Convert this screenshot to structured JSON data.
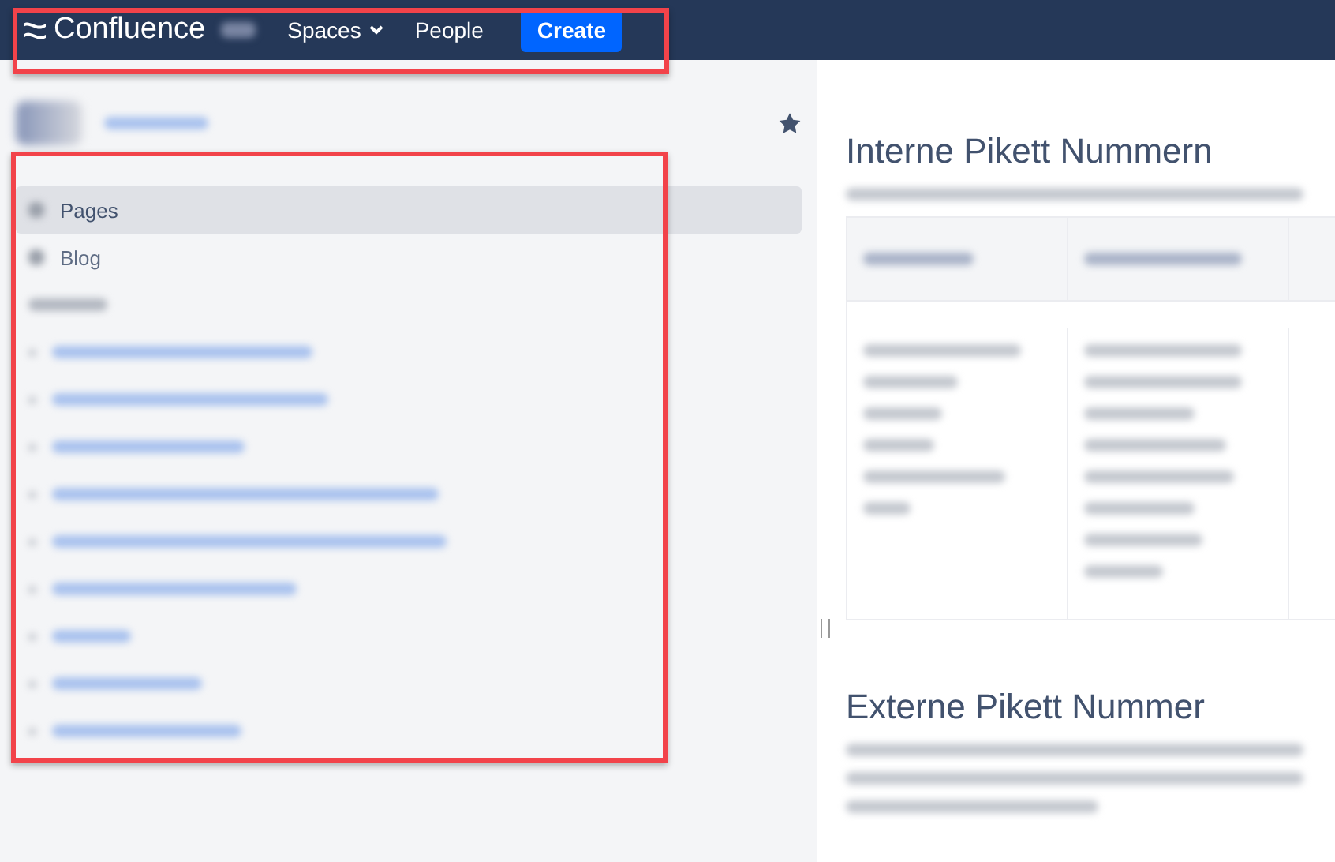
{
  "top_nav": {
    "product": "Confluence",
    "items": [
      {
        "label": "Spaces",
        "kind": "dropdown"
      },
      {
        "label": "People",
        "kind": "link"
      }
    ],
    "create_button": "Create"
  },
  "sidebar": {
    "items": [
      {
        "label": "Pages",
        "selected": true
      },
      {
        "label": "Blog",
        "selected": false
      }
    ],
    "starred": true
  },
  "content": {
    "headings": [
      "Interne Pikett Nummern",
      "Externe Pikett Nummer"
    ]
  }
}
